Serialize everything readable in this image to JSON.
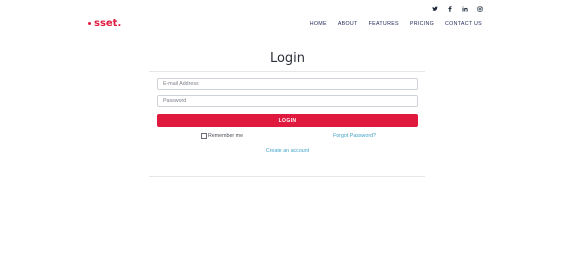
{
  "brand": {
    "logo_text": "sset.",
    "accent_color": "#e0193f"
  },
  "social": {
    "icons": [
      "twitter-icon",
      "facebook-icon",
      "linkedin-icon",
      "instagram-icon"
    ]
  },
  "nav": {
    "items": [
      "HOME",
      "ABOUT",
      "FEATURES",
      "PRICING",
      "CONTACT US"
    ]
  },
  "login": {
    "title": "Login",
    "email_placeholder": "E-mail Address",
    "password_placeholder": "Password",
    "button_label": "LOGIN",
    "remember_label": "Remember me",
    "forgot_label": "Forgot Password?",
    "create_label": "Create an account"
  }
}
